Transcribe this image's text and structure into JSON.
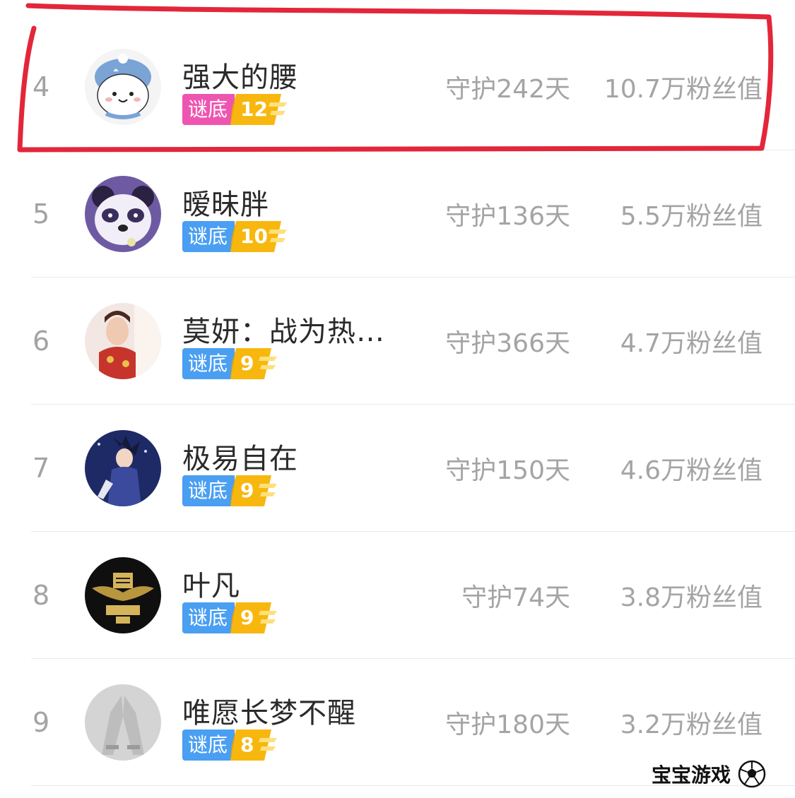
{
  "rows": [
    {
      "rank": "4",
      "name": "强大的腰",
      "badge_text": "谜底",
      "badge_level": "12",
      "badge_color": "#ee55b0",
      "guard": "守护242天",
      "fans": "10.7万粉丝值",
      "avatar": "cartoon-bear-hat"
    },
    {
      "rank": "5",
      "name": "暧昧胖",
      "badge_text": "谜底",
      "badge_level": "10",
      "badge_color": "#4a9ff2",
      "guard": "守护136天",
      "fans": "5.5万粉丝值",
      "avatar": "panda"
    },
    {
      "rank": "6",
      "name": "莫妍：战为热…",
      "badge_text": "谜底",
      "badge_level": "9",
      "badge_color": "#4a9ff2",
      "guard": "守护366天",
      "fans": "4.7万粉丝值",
      "avatar": "costume-girl"
    },
    {
      "rank": "7",
      "name": "极易自在",
      "badge_text": "谜底",
      "badge_level": "9",
      "badge_color": "#4a9ff2",
      "guard": "守护150天",
      "fans": "4.6万粉丝值",
      "avatar": "anime-ninja"
    },
    {
      "rank": "8",
      "name": "叶凡",
      "badge_text": "谜底",
      "badge_level": "9",
      "badge_color": "#4a9ff2",
      "guard": "守护74天",
      "fans": "3.8万粉丝值",
      "avatar": "dark-logo"
    },
    {
      "rank": "9",
      "name": "唯愿长梦不醒",
      "badge_text": "谜底",
      "badge_level": "8",
      "badge_color": "#4a9ff2",
      "guard": "守护180天",
      "fans": "3.2万粉丝值",
      "avatar": "grey-hands"
    }
  ],
  "watermark": {
    "text": "宝宝游戏",
    "icon": "soccer-ball-icon"
  },
  "highlight_color": "#e3263a"
}
